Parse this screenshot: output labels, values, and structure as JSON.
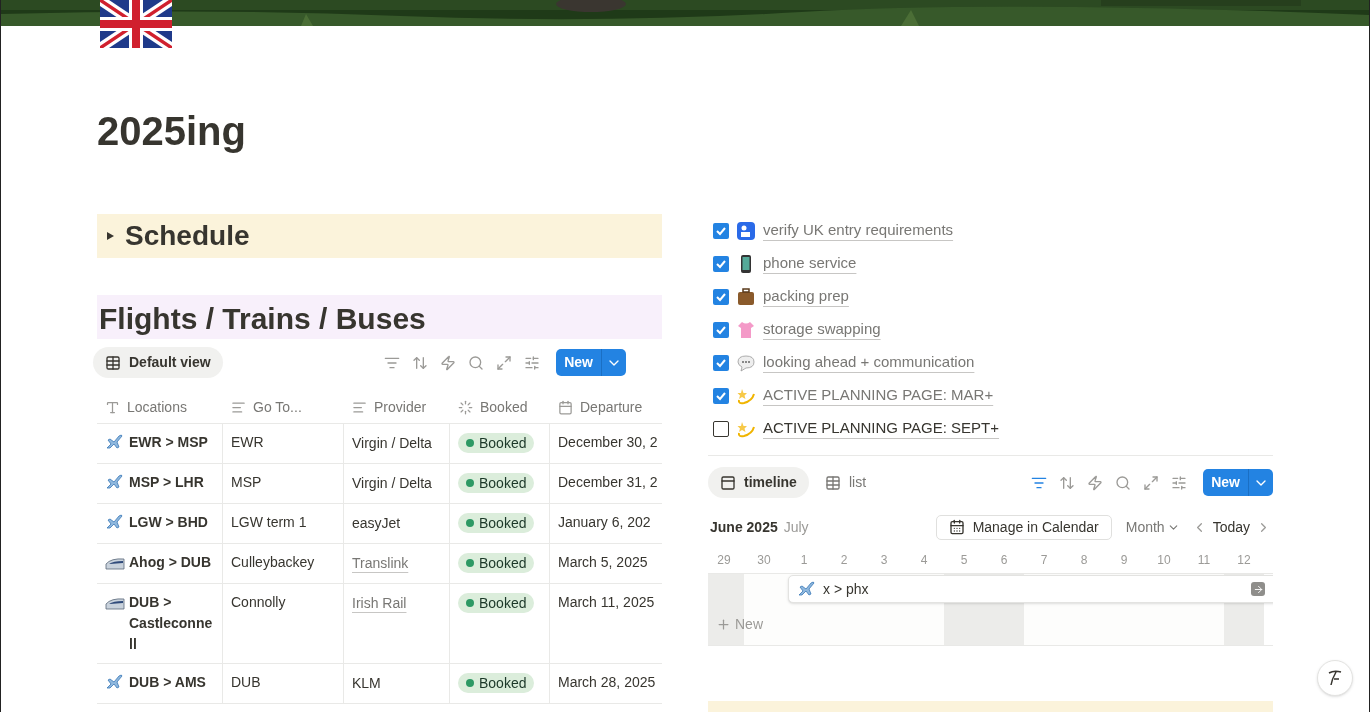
{
  "page": {
    "title": "2025ing"
  },
  "toggle": {
    "label": "Schedule",
    "expanded": false
  },
  "heading": "Flights / Trains / Buses",
  "table_view": {
    "tabs": [
      {
        "label": "Default view",
        "selected": true
      }
    ],
    "filter_active": false,
    "new_button": "New"
  },
  "table": {
    "columns": [
      {
        "label": "Locations",
        "kind": "title"
      },
      {
        "label": "Go To...",
        "kind": "text"
      },
      {
        "label": "Provider",
        "kind": "text"
      },
      {
        "label": "Booked",
        "kind": "status"
      },
      {
        "label": "Departure",
        "kind": "date"
      }
    ],
    "rows": [
      {
        "kind": "flight",
        "location": "EWR > MSP",
        "go_to": "EWR",
        "provider": "Virgin / Delta",
        "provider_link": false,
        "booked": "Booked",
        "departure": "December 30, 2"
      },
      {
        "kind": "flight",
        "location": "MSP > LHR",
        "go_to": "MSP",
        "provider": "Virgin / Delta",
        "provider_link": false,
        "booked": "Booked",
        "departure": "December 31, 2"
      },
      {
        "kind": "flight",
        "location": "LGW > BHD",
        "go_to": "LGW term 1",
        "provider": "easyJet",
        "provider_link": false,
        "booked": "Booked",
        "departure": "January 6, 202"
      },
      {
        "kind": "train",
        "location": "Ahog > DUB",
        "go_to": "Culleybackey",
        "provider": "Translink",
        "provider_link": true,
        "booked": "Booked",
        "departure": "March 5, 2025"
      },
      {
        "kind": "train",
        "location": "DUB > Castleconnell",
        "go_to": "Connolly",
        "provider": "Irish Rail",
        "provider_link": true,
        "booked": "Booked",
        "departure": "March 11, 2025"
      },
      {
        "kind": "flight",
        "location": "DUB > AMS",
        "go_to": "DUB",
        "provider": "KLM",
        "provider_link": false,
        "booked": "Booked",
        "departure": "March 28, 2025"
      }
    ]
  },
  "checklist": [
    {
      "kind": "passport",
      "label": "verify UK entry requirements",
      "checked": true
    },
    {
      "kind": "phone",
      "label": "phone service",
      "checked": true
    },
    {
      "kind": "luggage",
      "label": "packing prep",
      "checked": true
    },
    {
      "kind": "shirt",
      "label": "storage swapping",
      "checked": true
    },
    {
      "kind": "speech",
      "label": "looking ahead + communication",
      "checked": true
    },
    {
      "kind": "dizzy",
      "label": "ACTIVE PLANNING PAGE: MAR+",
      "checked": true
    },
    {
      "kind": "dizzy",
      "label": "ACTIVE PLANNING PAGE: SEPT+",
      "checked": false
    }
  ],
  "timeline_view": {
    "tabs": [
      {
        "label": "timeline",
        "kind": "timeline",
        "selected": true
      },
      {
        "label": "list",
        "kind": "table",
        "selected": false
      }
    ],
    "filter_active": true,
    "new_button": "New"
  },
  "timeline": {
    "month": "June 2025",
    "next_month": "July",
    "manage_button": "Manage in Calendar",
    "scale": "Month",
    "today": "Today",
    "days": [
      {
        "label": "29",
        "weekend": true
      },
      {
        "label": "30",
        "weekend": false
      },
      {
        "label": "1",
        "weekend": false
      },
      {
        "label": "2",
        "weekend": false
      },
      {
        "label": "3",
        "weekend": false
      },
      {
        "label": "4",
        "weekend": false
      },
      {
        "label": "5",
        "weekend": true
      },
      {
        "label": "6",
        "weekend": true
      },
      {
        "label": "7",
        "weekend": false
      },
      {
        "label": "8",
        "weekend": false
      },
      {
        "label": "9",
        "weekend": false
      },
      {
        "label": "10",
        "weekend": false
      },
      {
        "label": "11",
        "weekend": false
      },
      {
        "label": "12",
        "weekend": true
      }
    ],
    "item": {
      "kind": "flight",
      "label": "x > phx"
    },
    "add_label": "New"
  }
}
